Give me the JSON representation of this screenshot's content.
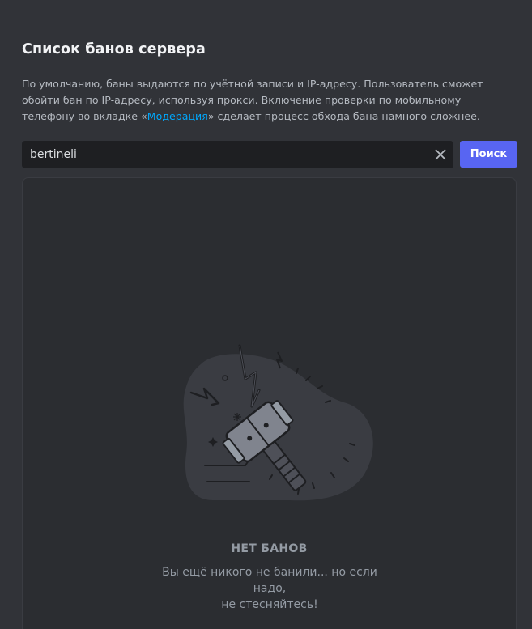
{
  "header": {
    "title": "Список банов сервера"
  },
  "description": {
    "text_before": "По умолчанию, баны выдаются по учётной записи и IP-адресу. Пользователь сможет обойти бан по IP-адресу, используя прокси. Включение проверки по мобильному телефону во вкладке «",
    "link": "Модерация",
    "text_after": "» сделает процесс обхода бана намного сложнее."
  },
  "search": {
    "value": "bertineli",
    "button_label": "Поиск",
    "clear_icon": "close-icon"
  },
  "empty_state": {
    "title": "НЕТ БАНОВ",
    "line1": "Вы ещё никого не банили... но если надо,",
    "line2": "не стесняйтесь!",
    "illustration": "ban-hammer-icon"
  },
  "colors": {
    "background": "#313338",
    "panel": "#2b2d31",
    "input": "#1e1f22",
    "accent": "#5865f2",
    "link": "#00a8fc"
  }
}
